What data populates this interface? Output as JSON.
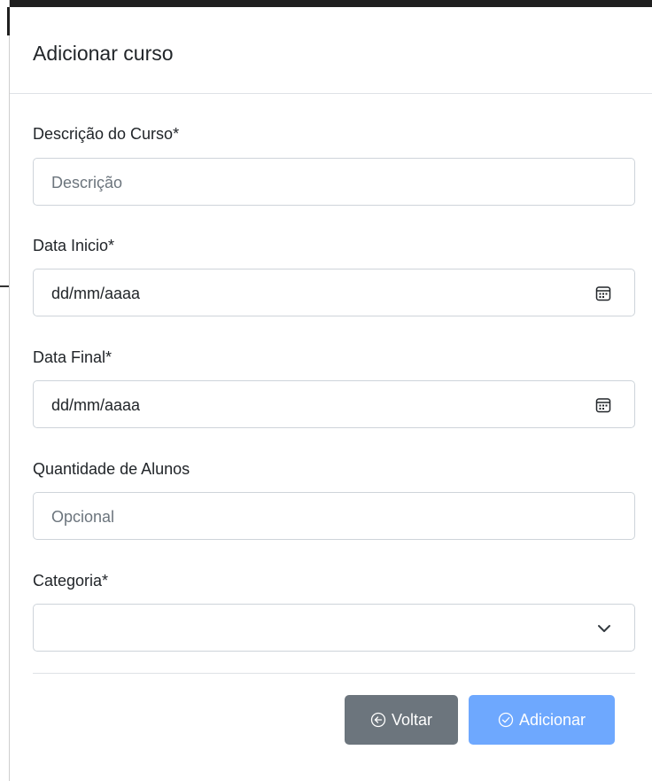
{
  "modal": {
    "title": "Adicionar curso"
  },
  "form": {
    "descricao": {
      "label": "Descrição do Curso*",
      "placeholder": "Descrição"
    },
    "data_inicio": {
      "label": "Data Inicio*",
      "value": "dd/mm/aaaa",
      "icon": "calendar-icon"
    },
    "data_final": {
      "label": "Data Final*",
      "value": "dd/mm/aaaa",
      "icon": "calendar-icon"
    },
    "quantidade": {
      "label": "Quantidade de Alunos",
      "placeholder": "Opcional"
    },
    "categoria": {
      "label": "Categoria*",
      "value": "",
      "icon": "chevron-down-icon"
    }
  },
  "footer": {
    "back_label": "Voltar",
    "back_icon": "arrow-left-circle-icon",
    "add_label": "Adicionar",
    "add_icon": "check-circle-icon"
  },
  "colors": {
    "back_button": "#6c757d",
    "add_button": "#6ea8fe",
    "border": "#ced4da",
    "divider": "#dee2e6"
  }
}
